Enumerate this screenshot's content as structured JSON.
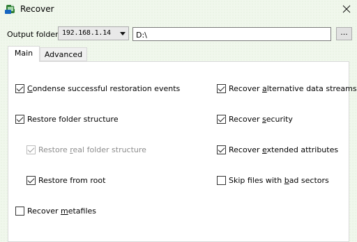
{
  "window": {
    "title": "Recover",
    "icon": "recover-app-icon",
    "close_icon": "close-icon"
  },
  "output": {
    "label": "Output folder:",
    "selected": "192.168.1.14",
    "path": "D:\\",
    "browse": "..."
  },
  "tabs": [
    {
      "label": "Main",
      "active": true
    },
    {
      "label": "Advanced",
      "active": false
    }
  ],
  "options_left": [
    {
      "pre": "",
      "acc": "C",
      "post": "ondense successful restoration events",
      "checked": true,
      "disabled": false
    },
    {
      "pre": "Restore folder structure",
      "acc": "",
      "post": "",
      "checked": true,
      "disabled": false
    },
    {
      "pre": "Restore ",
      "acc": "r",
      "post": "eal folder structure",
      "checked": true,
      "disabled": true
    },
    {
      "pre": "Restore from root",
      "acc": "",
      "post": "",
      "checked": true,
      "disabled": false
    },
    {
      "pre": "Recover ",
      "acc": "m",
      "post": "etafiles",
      "checked": false,
      "disabled": false
    }
  ],
  "options_right": [
    {
      "pre": "Recover ",
      "acc": "a",
      "post": "lternative data streams",
      "checked": true,
      "disabled": false
    },
    {
      "pre": "Recover ",
      "acc": "s",
      "post": "ecurity",
      "checked": true,
      "disabled": false
    },
    {
      "pre": "Recover ",
      "acc": "e",
      "post": "xtended attributes",
      "checked": true,
      "disabled": false
    },
    {
      "pre": "Skip files with ",
      "acc": "b",
      "post": "ad sectors",
      "checked": false,
      "disabled": false
    }
  ]
}
